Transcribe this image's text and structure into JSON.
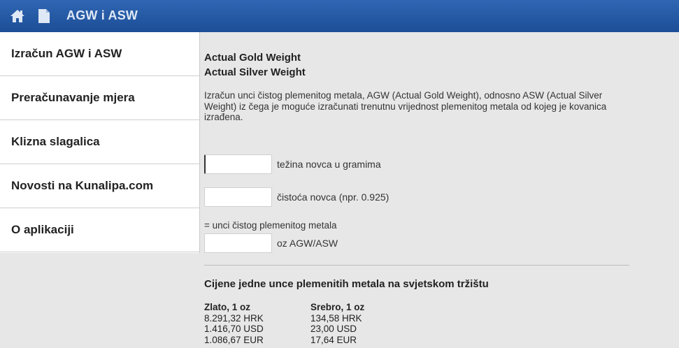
{
  "header": {
    "title": "AGW i ASW",
    "icons": [
      "home-icon",
      "document-icon"
    ]
  },
  "sidebar": {
    "items": [
      {
        "label": "Izračun AGW i ASW"
      },
      {
        "label": "Preračunavanje mjera"
      },
      {
        "label": "Klizna slagalica"
      },
      {
        "label": "Novosti na Kunalipa.com"
      },
      {
        "label": "O aplikaciji"
      }
    ]
  },
  "main": {
    "heading_line1": "Actual Gold Weight",
    "heading_line2": "Actual Silver Weight",
    "description": "Izračun unci čistog plemenitog metala, AGW (Actual Gold Weight), odnosno ASW (Actual Silver Weight) iz čega je moguće izračunati trenutnu vrijednost plemenitog metala od kojeg je kovanica izrađena.",
    "weight": {
      "value": "",
      "label": "težina novca u gramima"
    },
    "purity": {
      "value": "",
      "label": "čistoća novca (npr. 0.925)"
    },
    "equals_note": "= unci čistog plemenitog metala",
    "result": {
      "value": "",
      "label": "oz AGW/ASW"
    },
    "prices_title": "Cijene jedne unce plemenitih metala na svjetskom tržištu",
    "gold": {
      "title": "Zlato, 1 oz",
      "hrk": "8.291,32 HRK",
      "usd": "1.416,70 USD",
      "eur": "1.086,67 EUR"
    },
    "silver": {
      "title": "Srebro, 1 oz",
      "hrk": "134,58 HRK",
      "usd": "23,00 USD",
      "eur": "17,64 EUR"
    }
  }
}
